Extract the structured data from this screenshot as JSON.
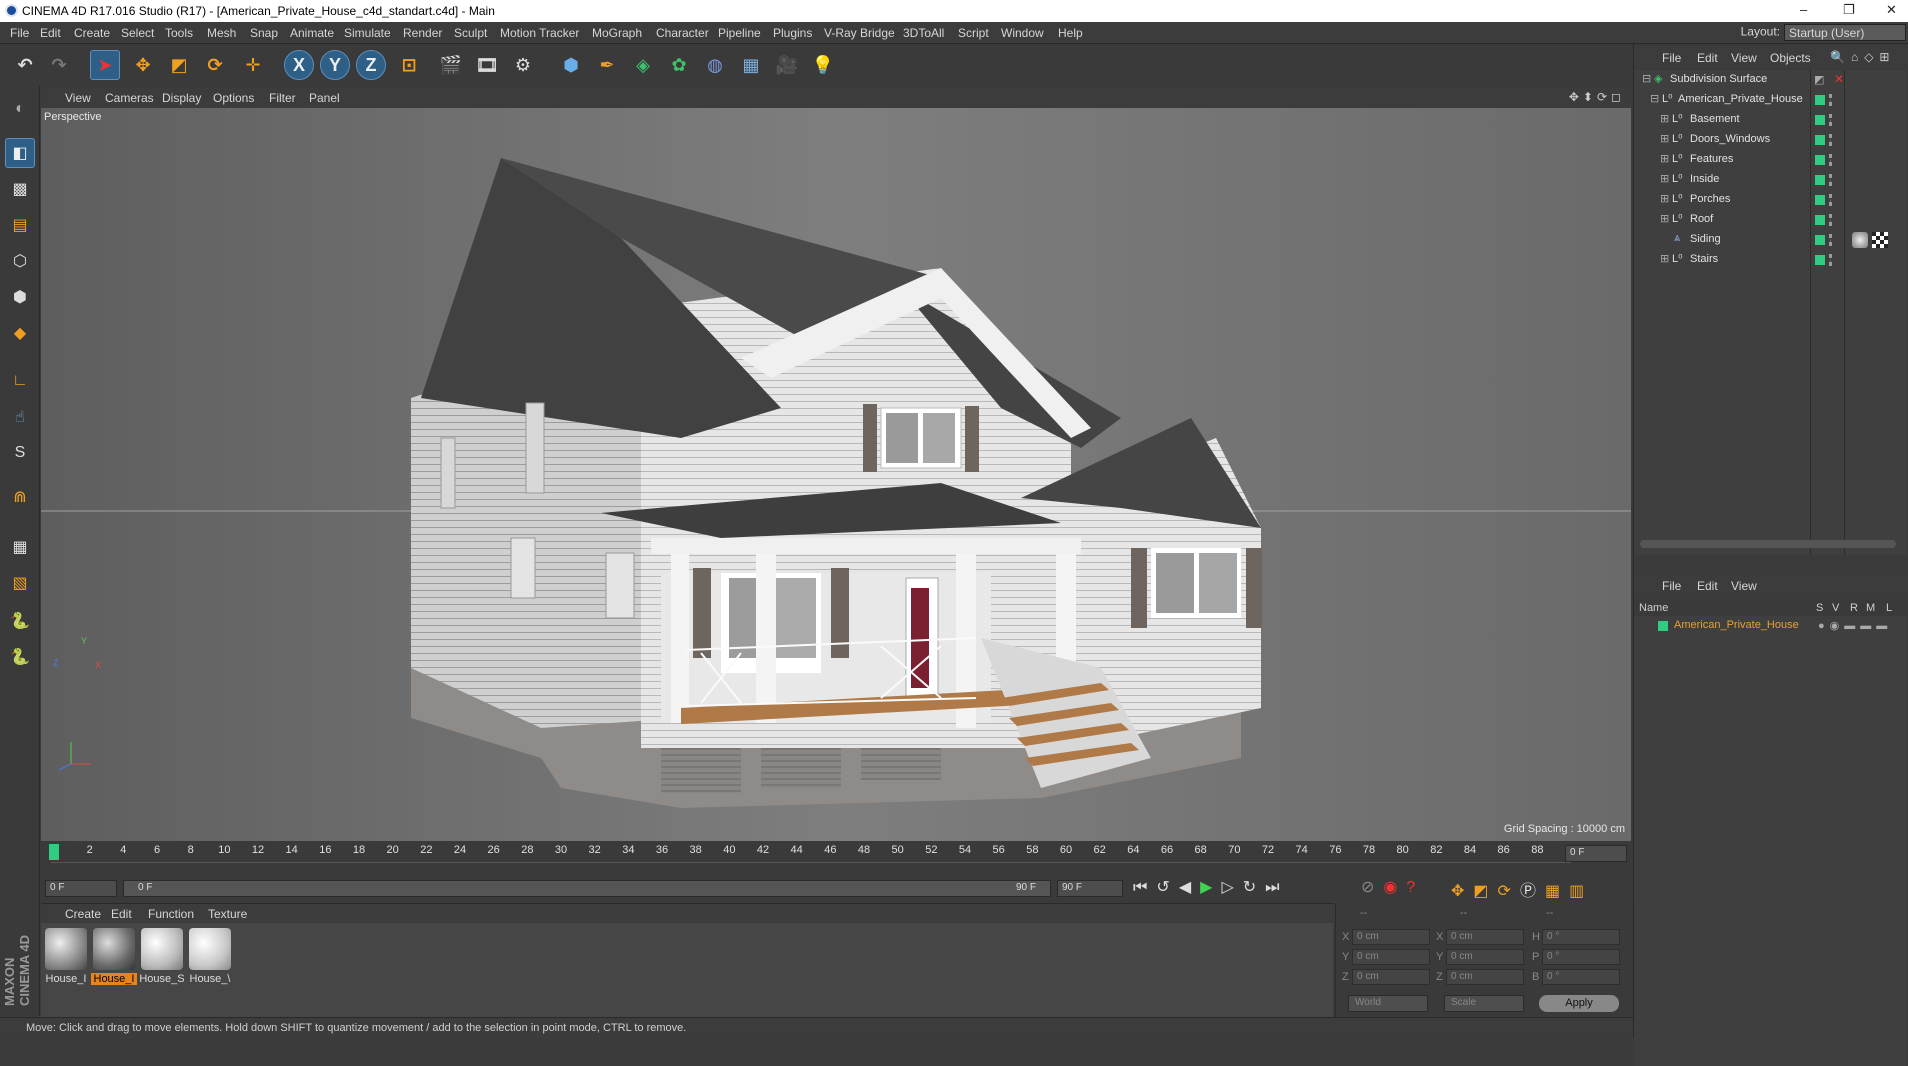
{
  "app": {
    "title": "CINEMA 4D R17.016 Studio (R17) - [American_Private_House_c4d_standart.c4d] - Main",
    "window_controls": [
      "–",
      "❐",
      "✕"
    ]
  },
  "menu": [
    "File",
    "Edit",
    "Create",
    "Select",
    "Tools",
    "Mesh",
    "Snap",
    "Animate",
    "Simulate",
    "Render",
    "Sculpt",
    "Motion Tracker",
    "MoGraph",
    "Character",
    "Pipeline",
    "Plugins",
    "V-Ray Bridge",
    "3DToAll",
    "Script",
    "Window",
    "Help"
  ],
  "layout": {
    "label": "Layout:",
    "value": "Startup (User)"
  },
  "viewport": {
    "menu": [
      "View",
      "Cameras",
      "Display",
      "Options",
      "Filter",
      "Panel"
    ],
    "label": "Perspective",
    "grid_spacing": "Grid Spacing : 10000 cm",
    "axis_labels": [
      "Y",
      "Z",
      "X"
    ]
  },
  "timeline": {
    "ticks": [
      "0",
      "2",
      "4",
      "6",
      "8",
      "10",
      "12",
      "14",
      "16",
      "18",
      "20",
      "22",
      "24",
      "26",
      "28",
      "30",
      "32",
      "34",
      "36",
      "38",
      "40",
      "42",
      "44",
      "46",
      "48",
      "50",
      "52",
      "54",
      "56",
      "58",
      "60",
      "62",
      "64",
      "66",
      "68",
      "70",
      "72",
      "74",
      "76",
      "78",
      "80",
      "82",
      "84",
      "86",
      "88",
      "90"
    ],
    "current_frame_right": "0 F",
    "start_field": "0 F",
    "range_start": "0 F",
    "range_end": "90 F",
    "end_field": "90 F"
  },
  "materials": {
    "menu": [
      "Create",
      "Edit",
      "Function",
      "Texture"
    ],
    "items": [
      {
        "label": "House_I"
      },
      {
        "label": "House_I"
      },
      {
        "label": "House_S"
      },
      {
        "label": "House_\\"
      }
    ]
  },
  "coordinates": {
    "headers": [
      "--",
      "--",
      "--"
    ],
    "rows": [
      {
        "a": "X",
        "av": "0 cm",
        "b": "X",
        "bv": "0 cm",
        "c": "H",
        "cv": "0 °"
      },
      {
        "a": "Y",
        "av": "0 cm",
        "b": "Y",
        "bv": "0 cm",
        "c": "P",
        "cv": "0 °"
      },
      {
        "a": "Z",
        "av": "0 cm",
        "b": "Z",
        "bv": "0 cm",
        "c": "B",
        "cv": "0 °"
      }
    ],
    "mode": "World",
    "scale": "Scale",
    "apply": "Apply"
  },
  "status": "Move: Click and drag to move elements. Hold down SHIFT to quantize movement / add to the selection in point mode, CTRL to remove.",
  "objects": {
    "menu": [
      "File",
      "Edit",
      "View",
      "Objects"
    ],
    "tree": [
      {
        "name": "Subdivision Surface",
        "indent": 0
      },
      {
        "name": "American_Private_House",
        "indent": 1
      },
      {
        "name": "Basement",
        "indent": 2
      },
      {
        "name": "Doors_Windows",
        "indent": 2
      },
      {
        "name": "Features",
        "indent": 2
      },
      {
        "name": "Inside",
        "indent": 2
      },
      {
        "name": "Porches",
        "indent": 2
      },
      {
        "name": "Roof",
        "indent": 2
      },
      {
        "name": "Siding",
        "indent": 2
      },
      {
        "name": "Stairs",
        "indent": 2
      }
    ]
  },
  "attributes": {
    "menu": [
      "File",
      "Edit",
      "View"
    ],
    "columns": [
      "Name",
      "S",
      "V",
      "R",
      "M",
      "L"
    ],
    "layer_name": "American_Private_House"
  },
  "brand": "MAXON CINEMA 4D",
  "colors": {
    "layer_green": "#2fcc82",
    "selection_orange": "#e8841c",
    "highlight_blue": "#2d5f87"
  }
}
